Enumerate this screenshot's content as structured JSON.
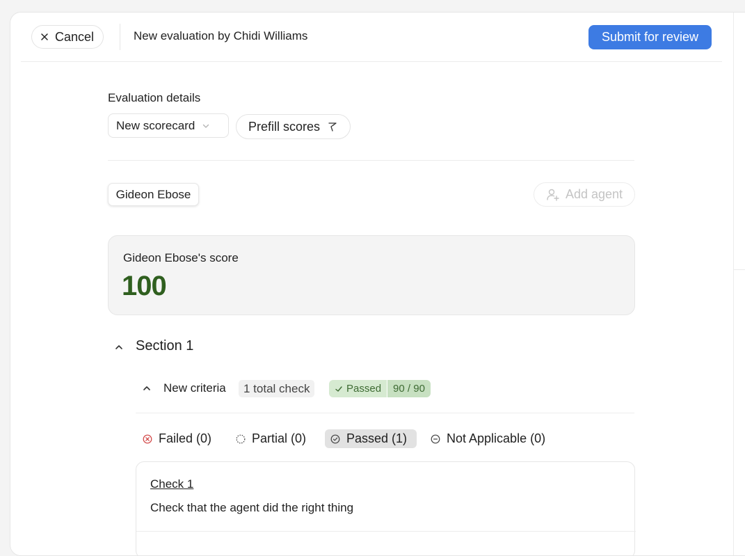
{
  "header": {
    "cancel_label": "Cancel",
    "title": "New evaluation by Chidi Williams",
    "submit_label": "Submit for review"
  },
  "details": {
    "heading": "Evaluation details",
    "scorecard_selected": "New scorecard",
    "prefill_label": "Prefill scores"
  },
  "agents": {
    "selected_agent": "Gideon Ebose",
    "add_agent_label": "Add agent"
  },
  "score": {
    "label": "Gideon Ebose's score",
    "value": "100"
  },
  "section": {
    "title": "Section 1",
    "criteria": {
      "title": "New criteria",
      "total_checks": "1 total check",
      "status_label": "Passed",
      "points": "90 / 90"
    },
    "filters": [
      {
        "label": "Failed (0)",
        "icon": "x-circle-icon",
        "color": "#d14343"
      },
      {
        "label": "Partial (0)",
        "icon": "dashed-circle-icon",
        "color": "#555555"
      },
      {
        "label": "Passed (1)",
        "icon": "check-circle-icon",
        "color": "#555555",
        "active": true
      },
      {
        "label": "Not Applicable (0)",
        "icon": "minus-circle-icon",
        "color": "#555555"
      }
    ],
    "check": {
      "name": "Check 1",
      "description": "Check that the agent did the right thing"
    }
  },
  "colors": {
    "accent": "#3d7be3",
    "score": "#2f5f1f",
    "passed_bg": "#d6ead1",
    "passed_text": "#3e6b33"
  }
}
